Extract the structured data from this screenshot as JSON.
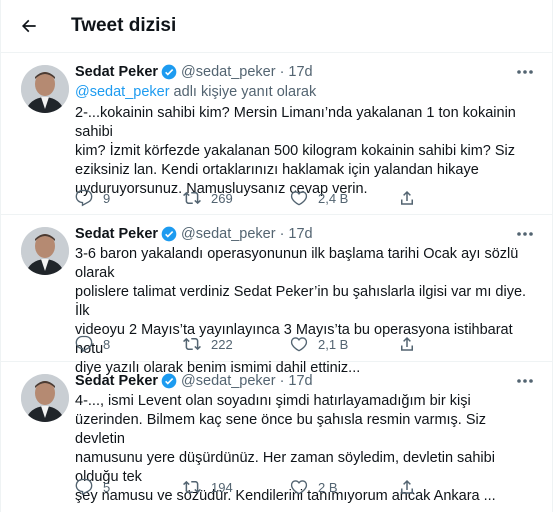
{
  "header": {
    "title": "Tweet dizisi"
  },
  "tweets": [
    {
      "name": "Sedat Peker",
      "handle": "@sedat_peker",
      "dot": "·",
      "time": "17d",
      "reply_handle": "@sedat_peker",
      "reply_suffix": " adlı kişiye yanıt olarak",
      "text": "2-...kokainin sahibi kim? Mersin Limanı’nda yakalanan 1 ton kokainin sahibi\nkim? İzmit körfezde yakalanan 500 kilogram kokainin sahibi kim? Siz\neziksiniz lan. Kendi ortaklarınızı haklamak için yalandan hikaye\nuyduruyorsunuz. Namusluysanız cevap verin.",
      "replies": "9",
      "retweets": "269",
      "likes": "2,4 B"
    },
    {
      "name": "Sedat Peker",
      "handle": "@sedat_peker",
      "dot": "·",
      "time": "17d",
      "text": "3-6 baron yakalandı operasyonunun ilk başlama tarihi Ocak ayı sözlü olarak\npolislere talimat verdiniz Sedat Peker’in bu şahıslarla ilgisi var mı diye. İlk\nvideoyu 2 Mayıs’ta yayınlayınca 3 Mayıs’ta bu operasyona istihbarat notu\ndiye yazılı olarak benim ismimi dahil ettiniz...",
      "replies": "8",
      "retweets": "222",
      "likes": "2,1 B"
    },
    {
      "name": "Sedat Peker",
      "handle": "@sedat_peker",
      "dot": "·",
      "time": "17d",
      "text": "4-..., ismi Levent olan soyadını şimdi hatırlayamadığım bir kişi\nüzerinden.  Bilmem kaç sene önce bu şahısla resmin varmış. Siz devletin\nnamusunu yere düşürdünüz. Her zaman söyledim, devletin sahibi olduğu tek\nşey namusu ve sözüdür. Kendilerini tanımıyorum ancak Ankara ...",
      "replies": "5",
      "retweets": "194",
      "likes": "2 B"
    }
  ],
  "colors": {
    "accent": "#1d9bf0",
    "secondary_text": "#536471",
    "divider": "#eff3f4"
  },
  "icons": {
    "back": "arrow-left-icon",
    "verified": "verified-badge-icon",
    "more": "more-dots-icon",
    "reply": "reply-bubble-icon",
    "retweet": "retweet-icon",
    "like": "heart-icon",
    "share": "share-icon"
  }
}
